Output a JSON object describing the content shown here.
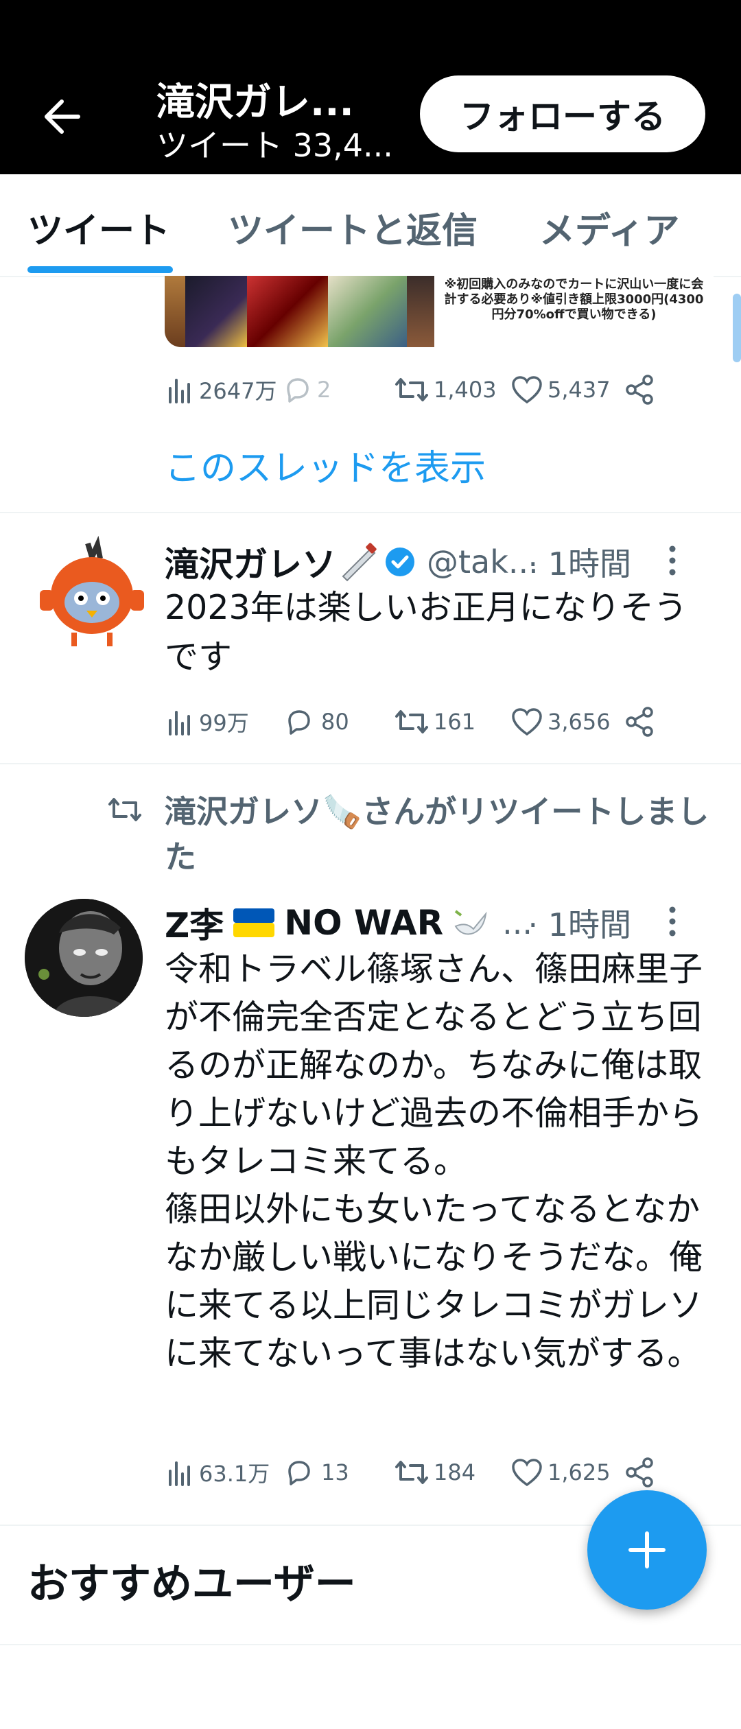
{
  "header": {
    "title": "滝沢ガレ...",
    "subtitle": "ツイート 33,4..."
  },
  "follow_label": "フォローする",
  "tabs": [
    "ツイート",
    "ツイートと返信",
    "メディア"
  ],
  "promo_text": "※初回購入のみなのでカートに沢山い一度に会計する必要あり※値引き額上限3000円(4300円分70%offで買い物できる)",
  "tweet0": {
    "views": "2647万",
    "replies": "2",
    "retweets": "1,403",
    "likes": "5,437",
    "show_thread": "このスレッドを表示"
  },
  "tweet1": {
    "name": "滝沢ガレソ",
    "handle": "@tak...",
    "time": "· 1時間",
    "text": "2023年は楽しいお正月になりそうです",
    "views": "99万",
    "replies": "80",
    "retweets": "161",
    "likes": "3,656"
  },
  "retweet_label": "滝沢ガレソ🪚さんがリツイートしました",
  "tweet2": {
    "name": "Z李",
    "name_suffix": "NO WAR",
    "ellipsis": "...",
    "time": "· 1時間",
    "text": "令和トラベル篠塚さん、篠田麻里子が不倫完全否定となるとどう立ち回るのが正解なのか。ちなみに俺は取り上げないけど過去の不倫相手からもタレコミ来てる。\n篠田以外にも女いたってなるとなかなか厳しい戦いになりそうだな。俺に来てる以上同じタレコミがガレソに来てないって事はない気がする。",
    "views": "63.1万",
    "replies": "13",
    "retweets": "184",
    "likes": "1,625"
  },
  "recommend_title": "おすすめユーザー",
  "colors": {
    "accent": "#1d9bf0",
    "muted": "#536471"
  }
}
